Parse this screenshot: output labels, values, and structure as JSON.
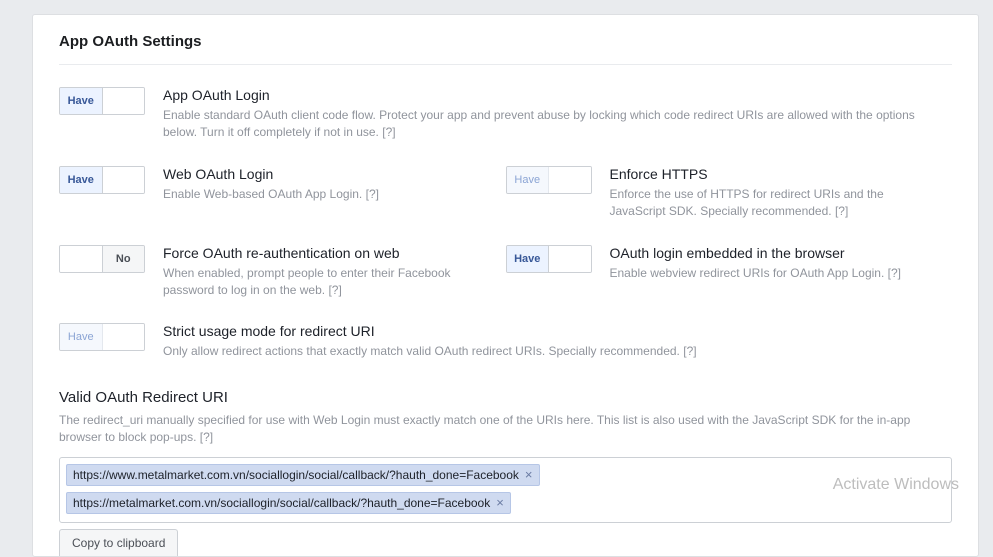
{
  "page_title": "App OAuth Settings",
  "toggles": {
    "have": "Have",
    "no": "No"
  },
  "help_glyph": "[?]",
  "settings": {
    "app_oauth": {
      "title": "App OAuth Login",
      "desc": "Enable standard OAuth client code flow. Protect your app and prevent abuse by locking which code redirect URIs are allowed with the options below. Turn it off completely if not in use.",
      "state": "have"
    },
    "web_oauth": {
      "title": "Web OAuth Login",
      "desc": "Enable Web-based OAuth App Login.",
      "state": "have"
    },
    "enforce_https": {
      "title": "Enforce HTTPS",
      "desc": "Enforce the use of HTTPS for redirect URIs and the JavaScript SDK. Specially recommended.",
      "state": "have_locked"
    },
    "force_reauth": {
      "title": "Force OAuth re-authentication on web",
      "desc": "When enabled, prompt people to enter their Facebook password to log in on the web.",
      "state": "no"
    },
    "embedded": {
      "title": "OAuth login embedded in the browser",
      "desc": "Enable webview redirect URIs for OAuth App Login.",
      "state": "have"
    },
    "strict": {
      "title": "Strict usage mode for redirect URI",
      "desc": "Only allow redirect actions that exactly match valid OAuth redirect URIs. Specially recommended.",
      "state": "have_locked"
    }
  },
  "valid_redirect": {
    "title": "Valid OAuth Redirect URI",
    "desc": "The redirect_uri manually specified for use with Web Login must exactly match one of the URIs here. This list is also used with the JavaScript SDK for the in-app browser to block pop-ups.",
    "uris": [
      "https://www.metalmarket.com.vn/sociallogin/social/callback/?hauth_done=Facebook",
      "https://metalmarket.com.vn/sociallogin/social/callback/?hauth_done=Facebook"
    ],
    "copy_label": "Copy to clipboard"
  },
  "watermark": "Activate Windows"
}
